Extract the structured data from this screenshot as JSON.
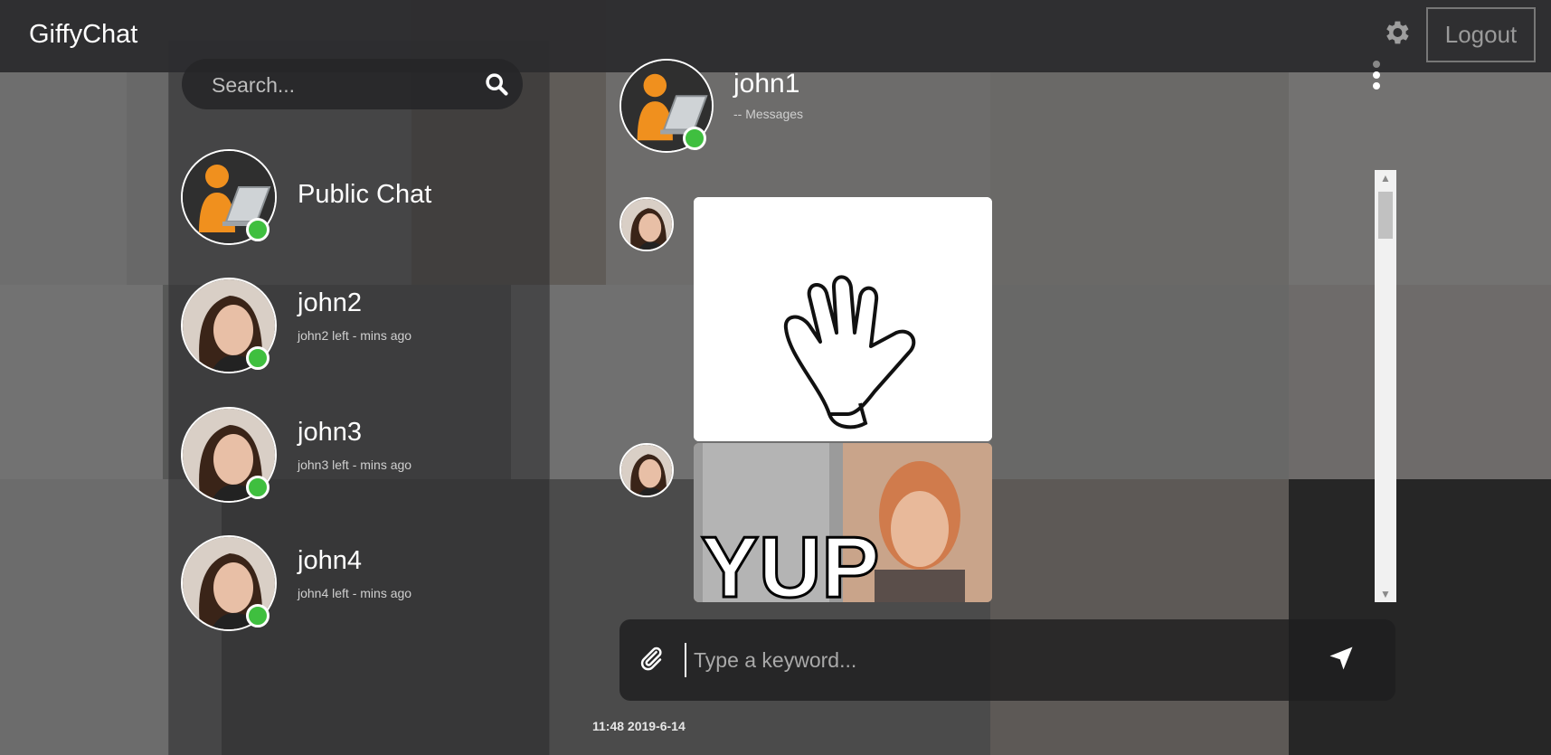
{
  "app": {
    "title": "GiffyChat",
    "logout_label": "Logout",
    "icons": {
      "settings": "gear-icon"
    }
  },
  "sidebar": {
    "search_placeholder": "Search...",
    "contacts": [
      {
        "name": "Public Chat",
        "status": "",
        "online": true
      },
      {
        "name": "john2",
        "status": "john2 left - mins ago",
        "online": true
      },
      {
        "name": "john3",
        "status": "john3 left - mins ago",
        "online": true
      },
      {
        "name": "john4",
        "status": "john4 left - mins ago",
        "online": true
      }
    ]
  },
  "chat": {
    "title": "john1",
    "subtitle": "-- Messages",
    "messages": [
      {
        "type": "gif",
        "description": "waving-hand-gif"
      },
      {
        "type": "gif",
        "caption": "YUP"
      }
    ],
    "input_placeholder": "Type a keyword...",
    "timestamp": "11:48 2019-6-14"
  },
  "colors": {
    "online": "#3fbf3f",
    "topbar": "#2d2d2f",
    "accent_orange": "#f0901e"
  }
}
